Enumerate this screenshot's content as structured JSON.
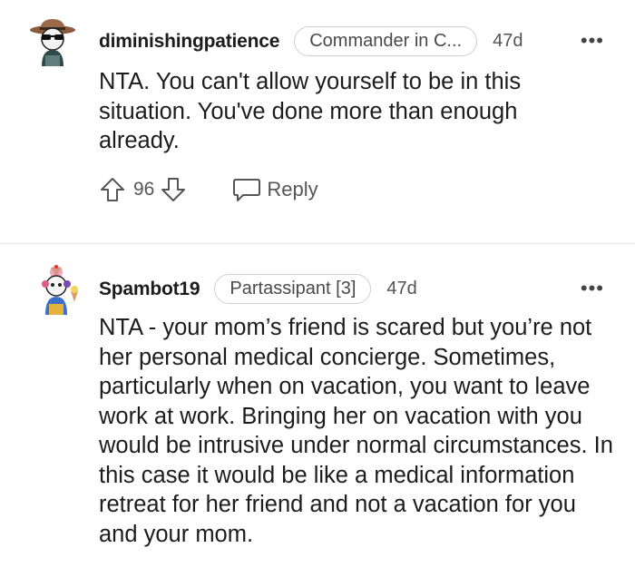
{
  "comments": [
    {
      "username": "diminishingpatience",
      "flair": "Commander in C...",
      "age": "47d",
      "more": "•••",
      "body": "NTA. You can't allow yourself to be in this situation. You've done more than enough already.",
      "score": "96",
      "reply_label": "Reply",
      "avatar_icon": "sunglasses-cowboy-avatar-icon"
    },
    {
      "username": "Spambot19",
      "flair": "Partassipant [3]",
      "age": "47d",
      "more": "•••",
      "body": "NTA - your mom’s friend is scared but you’re not her personal medical concierge. Sometimes, particularly when on vacation, you want to leave work at work. Bringing her on vacation with you would be intrusive under normal circumstances. In this case it would be like a medical information retreat for her friend and not a vacation for you and your mom.",
      "avatar_icon": "ice-cream-avatar-icon"
    }
  ],
  "colors": {
    "text": "#1c1c1c",
    "muted": "#555555",
    "border": "#cfcfcf",
    "divider": "#e6e6e6"
  }
}
